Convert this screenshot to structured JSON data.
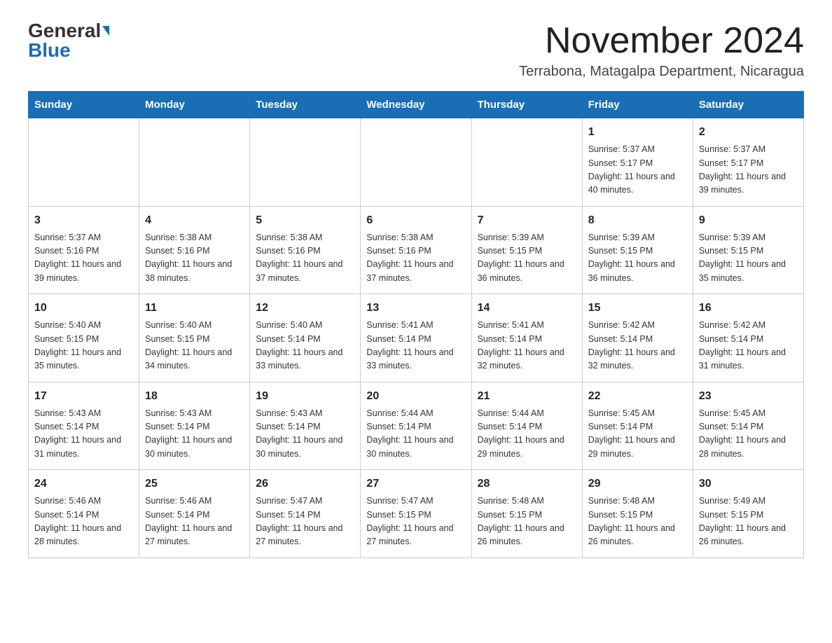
{
  "logo": {
    "general": "General",
    "blue": "Blue",
    "tagline": ""
  },
  "title": {
    "month_year": "November 2024",
    "location": "Terrabona, Matagalpa Department, Nicaragua"
  },
  "weekdays": [
    "Sunday",
    "Monday",
    "Tuesday",
    "Wednesday",
    "Thursday",
    "Friday",
    "Saturday"
  ],
  "weeks": [
    [
      {
        "day": "",
        "info": ""
      },
      {
        "day": "",
        "info": ""
      },
      {
        "day": "",
        "info": ""
      },
      {
        "day": "",
        "info": ""
      },
      {
        "day": "",
        "info": ""
      },
      {
        "day": "1",
        "info": "Sunrise: 5:37 AM\nSunset: 5:17 PM\nDaylight: 11 hours and 40 minutes."
      },
      {
        "day": "2",
        "info": "Sunrise: 5:37 AM\nSunset: 5:17 PM\nDaylight: 11 hours and 39 minutes."
      }
    ],
    [
      {
        "day": "3",
        "info": "Sunrise: 5:37 AM\nSunset: 5:16 PM\nDaylight: 11 hours and 39 minutes."
      },
      {
        "day": "4",
        "info": "Sunrise: 5:38 AM\nSunset: 5:16 PM\nDaylight: 11 hours and 38 minutes."
      },
      {
        "day": "5",
        "info": "Sunrise: 5:38 AM\nSunset: 5:16 PM\nDaylight: 11 hours and 37 minutes."
      },
      {
        "day": "6",
        "info": "Sunrise: 5:38 AM\nSunset: 5:16 PM\nDaylight: 11 hours and 37 minutes."
      },
      {
        "day": "7",
        "info": "Sunrise: 5:39 AM\nSunset: 5:15 PM\nDaylight: 11 hours and 36 minutes."
      },
      {
        "day": "8",
        "info": "Sunrise: 5:39 AM\nSunset: 5:15 PM\nDaylight: 11 hours and 36 minutes."
      },
      {
        "day": "9",
        "info": "Sunrise: 5:39 AM\nSunset: 5:15 PM\nDaylight: 11 hours and 35 minutes."
      }
    ],
    [
      {
        "day": "10",
        "info": "Sunrise: 5:40 AM\nSunset: 5:15 PM\nDaylight: 11 hours and 35 minutes."
      },
      {
        "day": "11",
        "info": "Sunrise: 5:40 AM\nSunset: 5:15 PM\nDaylight: 11 hours and 34 minutes."
      },
      {
        "day": "12",
        "info": "Sunrise: 5:40 AM\nSunset: 5:14 PM\nDaylight: 11 hours and 33 minutes."
      },
      {
        "day": "13",
        "info": "Sunrise: 5:41 AM\nSunset: 5:14 PM\nDaylight: 11 hours and 33 minutes."
      },
      {
        "day": "14",
        "info": "Sunrise: 5:41 AM\nSunset: 5:14 PM\nDaylight: 11 hours and 32 minutes."
      },
      {
        "day": "15",
        "info": "Sunrise: 5:42 AM\nSunset: 5:14 PM\nDaylight: 11 hours and 32 minutes."
      },
      {
        "day": "16",
        "info": "Sunrise: 5:42 AM\nSunset: 5:14 PM\nDaylight: 11 hours and 31 minutes."
      }
    ],
    [
      {
        "day": "17",
        "info": "Sunrise: 5:43 AM\nSunset: 5:14 PM\nDaylight: 11 hours and 31 minutes."
      },
      {
        "day": "18",
        "info": "Sunrise: 5:43 AM\nSunset: 5:14 PM\nDaylight: 11 hours and 30 minutes."
      },
      {
        "day": "19",
        "info": "Sunrise: 5:43 AM\nSunset: 5:14 PM\nDaylight: 11 hours and 30 minutes."
      },
      {
        "day": "20",
        "info": "Sunrise: 5:44 AM\nSunset: 5:14 PM\nDaylight: 11 hours and 30 minutes."
      },
      {
        "day": "21",
        "info": "Sunrise: 5:44 AM\nSunset: 5:14 PM\nDaylight: 11 hours and 29 minutes."
      },
      {
        "day": "22",
        "info": "Sunrise: 5:45 AM\nSunset: 5:14 PM\nDaylight: 11 hours and 29 minutes."
      },
      {
        "day": "23",
        "info": "Sunrise: 5:45 AM\nSunset: 5:14 PM\nDaylight: 11 hours and 28 minutes."
      }
    ],
    [
      {
        "day": "24",
        "info": "Sunrise: 5:46 AM\nSunset: 5:14 PM\nDaylight: 11 hours and 28 minutes."
      },
      {
        "day": "25",
        "info": "Sunrise: 5:46 AM\nSunset: 5:14 PM\nDaylight: 11 hours and 27 minutes."
      },
      {
        "day": "26",
        "info": "Sunrise: 5:47 AM\nSunset: 5:14 PM\nDaylight: 11 hours and 27 minutes."
      },
      {
        "day": "27",
        "info": "Sunrise: 5:47 AM\nSunset: 5:15 PM\nDaylight: 11 hours and 27 minutes."
      },
      {
        "day": "28",
        "info": "Sunrise: 5:48 AM\nSunset: 5:15 PM\nDaylight: 11 hours and 26 minutes."
      },
      {
        "day": "29",
        "info": "Sunrise: 5:48 AM\nSunset: 5:15 PM\nDaylight: 11 hours and 26 minutes."
      },
      {
        "day": "30",
        "info": "Sunrise: 5:49 AM\nSunset: 5:15 PM\nDaylight: 11 hours and 26 minutes."
      }
    ]
  ]
}
